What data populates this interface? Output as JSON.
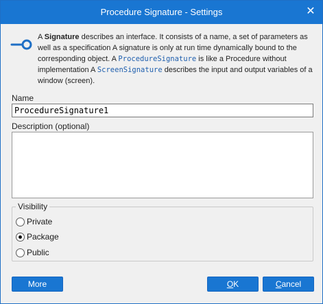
{
  "window": {
    "title": "Procedure Signature - Settings",
    "close_glyph": "✕"
  },
  "info": {
    "icon": "signature-icon",
    "text_parts": {
      "p1": "A ",
      "bold1": "Signature",
      "p2": " describes an interface. It consists of a name, a set of parameters as well as a specification A signature is only at run time dynamically bound to the corresponding object. A ",
      "code1": "ProcedureSignature",
      "p3": " is like a Procedure without implementation A ",
      "code2": "ScreenSignature",
      "p4": " describes the input and output variables of a window (screen)."
    }
  },
  "form": {
    "name_label": "Name",
    "name_value": "ProcedureSignature1",
    "description_label": "Description (optional)",
    "description_value": ""
  },
  "visibility": {
    "legend": "Visibility",
    "options": [
      {
        "label": "Private",
        "checked": false
      },
      {
        "label": "Package",
        "checked": true
      },
      {
        "label": "Public",
        "checked": false
      }
    ]
  },
  "buttons": {
    "more": "More",
    "ok_mnemonic": "O",
    "ok_rest": "K",
    "cancel_mnemonic": "C",
    "cancel_rest": "ancel"
  },
  "colors": {
    "accent": "#1976d2",
    "code_text": "#1f5fae",
    "background": "#f0f0f0"
  }
}
